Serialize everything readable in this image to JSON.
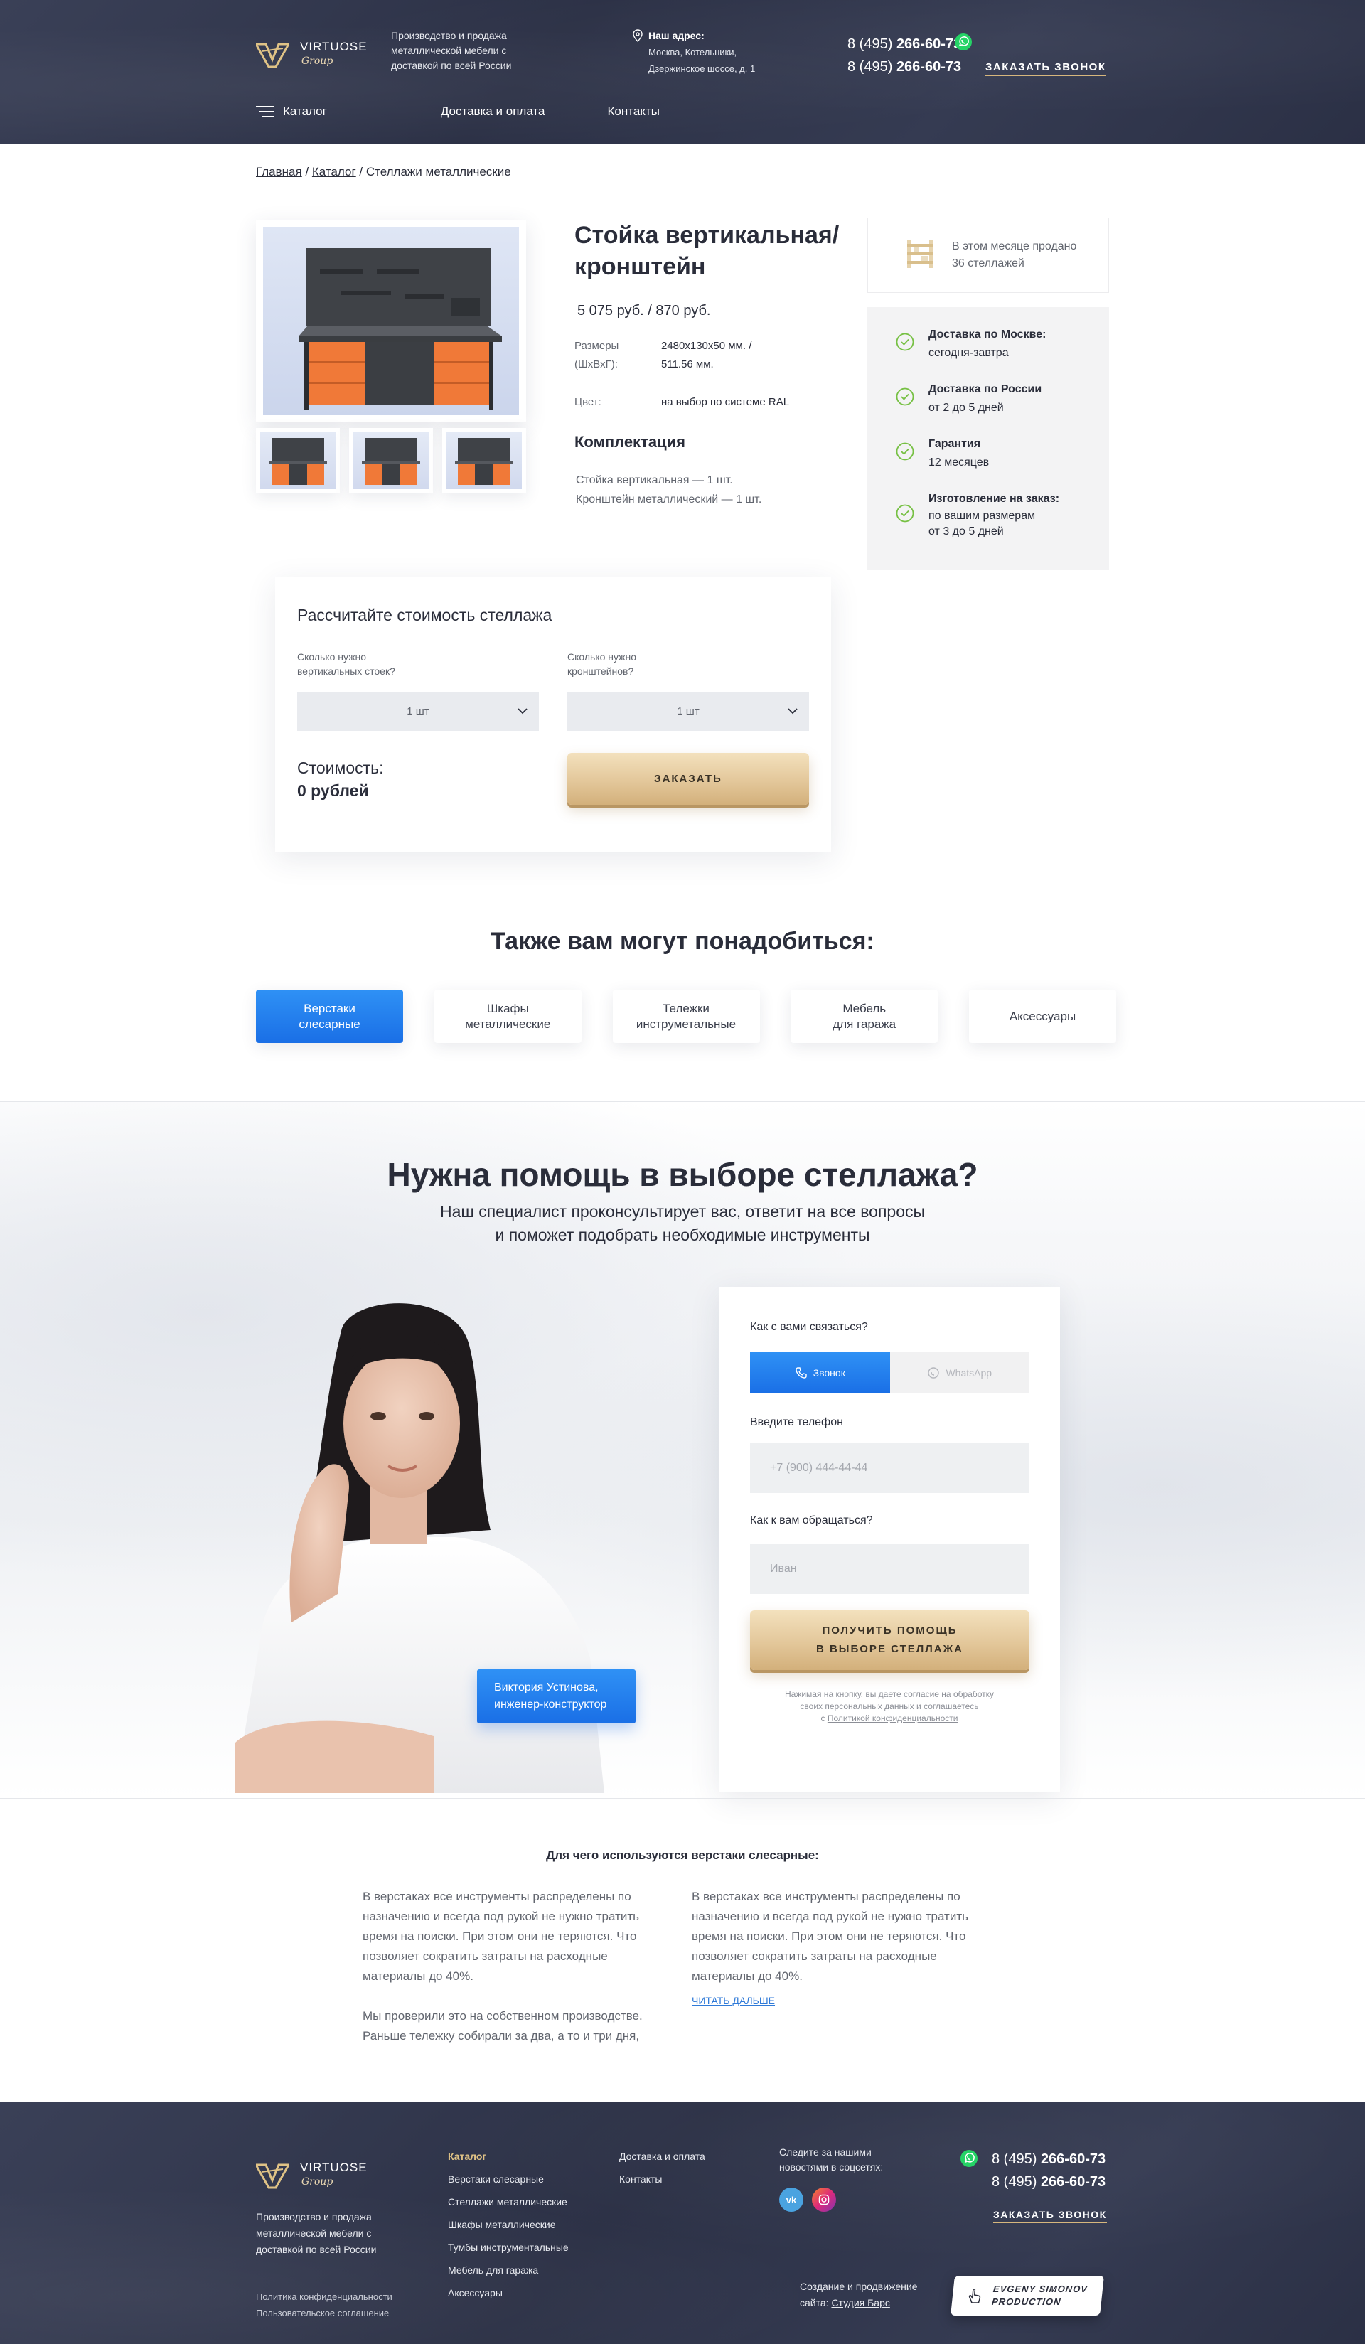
{
  "header": {
    "logo_name": "VIRTUOSE",
    "logo_sub": "Group",
    "tagline": "Производство и продажа металлической мебели с доставкой по всей России",
    "address_title": "Наш адрес:",
    "address_line1": "Москва, Котельники,",
    "address_line2": "Дзержинское шоссе, д. 1",
    "phone1_prefix": "8 (495) ",
    "phone1_number": "266-60-73",
    "phone2_prefix": "8 (495) ",
    "phone2_number": "266-60-73",
    "callback": "ЗАКАЗАТЬ ЗВОНОК",
    "nav": [
      "Каталог",
      "Доставка и оплата",
      "Контакты"
    ]
  },
  "breadcrumb": {
    "home": "Главная",
    "sep1": " / ",
    "catalog": "Каталог",
    "sep2": " / ",
    "current": "Стеллажи металлические"
  },
  "product": {
    "title": "Стойка вертикальная/ кронштейн",
    "price": "5 075 руб. / 870 руб.",
    "size_label_1": "Размеры",
    "size_label_2": "(ШхВхГ):",
    "size_value_1": "2480x130x50 мм. /",
    "size_value_2": "511.56 мм.",
    "color_label": "Цвет:",
    "color_value": "на выбор по системе RAL",
    "komplekt_title": "Комплектация",
    "komplekt_items": [
      "Стойка вертикальная — 1 шт.",
      "Кронштейн металлический — 1 шт."
    ]
  },
  "sold": {
    "line1": "В этом месяце продано",
    "line2": "36 стеллажей"
  },
  "info": [
    {
      "title": "Доставка по Москве:",
      "text": "сегодня-завтра"
    },
    {
      "title": "Доставка по России",
      "text": "от 2 до 5 дней"
    },
    {
      "title": "Гарантия",
      "text": "12 месяцев"
    },
    {
      "title": "Изготовление на заказ:",
      "text": "по вашим размерам",
      "text2": "от 3 до 5 дней"
    }
  ],
  "calc": {
    "title": "Рассчитайте стоимость стеллажа",
    "label1_a": "Сколько нужно",
    "label1_b": "вертикальных стоек?",
    "label2_a": "Сколько нужно",
    "label2_b": "кронштейнов?",
    "select1": "1 шт",
    "select2": "1 шт",
    "cost_label": "Стоимость:",
    "cost_value": "0 рублей",
    "order": "ЗАКАЗАТЬ"
  },
  "also": {
    "title": "Также вам могут понадобиться:",
    "cats": [
      {
        "l1": "Верстаки",
        "l2": "слесарные"
      },
      {
        "l1": "Шкафы",
        "l2": "металлические"
      },
      {
        "l1": "Тележки",
        "l2": "инструметальные"
      },
      {
        "l1": "Мебель",
        "l2": "для гаража"
      },
      {
        "l1": "Аксессуары",
        "l2": ""
      }
    ]
  },
  "help": {
    "title": "Нужна помощь в выборе стеллажа?",
    "sub1": "Наш специалист проконсультирует вас, ответит на все вопросы",
    "sub2": "и поможет подобрать необходимые инструменты",
    "specialist_line1": "Виктория Устинова,",
    "specialist_line2": "инженер-конструктор",
    "form_contact_label": "Как с вами связаться?",
    "opt_call": "Звонок",
    "opt_whatsapp": "WhatsApp",
    "phone_label": "Введите телефон",
    "phone_placeholder": "+7 (900) 444-44-44",
    "name_label": "Как к вам обращаться?",
    "name_placeholder": "Иван",
    "button_l1": "ПОЛУЧИТЬ ПОМОЩЬ",
    "button_l2": "В ВЫБОРЕ СТЕЛЛАЖА",
    "consent_1": "Нажимая на кнопку, вы даете согласие на обработку",
    "consent_2": "своих персональных данных и соглашаетесь",
    "consent_3": "с ",
    "consent_link": "Политикой конфиденциальности"
  },
  "article": {
    "title": "Для чего используются верстаки слесарные:",
    "col1_p1": "В верстаках все инструменты распределены по назначению и всегда под рукой   не нужно тратить время на поиски.  При этом они не теряются. Что позволяет сократить затраты на расходные материалы до 40%.",
    "col1_p2": "Мы проверили это на собственном производстве. Раньше тележку собирали за два, а то и три дня,",
    "col2_p1": "В верстаках все инструменты распределены по назначению и всегда под рукой   не нужно тратить время на поиски.  При этом они не теряются. Что позволяет сократить затраты на расходные материалы до 40%.",
    "read_more": "ЧИТАТЬ ДАЛЬШЕ"
  },
  "footer": {
    "logo_name": "VIRTUOSE",
    "logo_sub": "Group",
    "desc": "Производство и продажа металлической мебели с доставкой по всей России",
    "privacy": "Политика конфиденциальности",
    "agreement": "Пользовательское соглашение",
    "col1": [
      "Каталог",
      "Верстаки слесарные",
      "Стеллажи металлические",
      "Шкафы металлические",
      "Тумбы инструментальные",
      "Мебель для гаража",
      "Аксессуары"
    ],
    "col2": [
      "Доставка и оплата",
      "Контакты"
    ],
    "social_text": "Следите за нашими новостями в соцсетях:",
    "vk": "vk",
    "phone1_prefix": "8 (495) ",
    "phone1_number": "266-60-73",
    "phone2_prefix": "8 (495) ",
    "phone2_number": "266-60-73",
    "callback": "ЗАКАЗАТЬ ЗВОНОК",
    "studio_line1": "Создание и продвижение",
    "studio_line2": "сайта: ",
    "studio_link": "Студия  Барс",
    "evgeny_l1": "EVGENY SIMONOV",
    "evgeny_l2": "PRODUCTION"
  }
}
